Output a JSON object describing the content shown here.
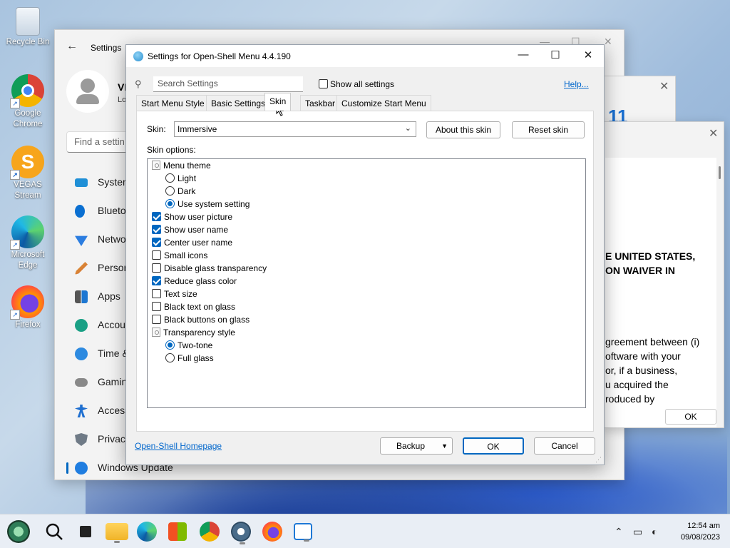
{
  "desktop": {
    "icons": [
      {
        "label": "Recycle Bin",
        "icon": "recycle-bin-icon"
      },
      {
        "label": "Google Chrome",
        "icon": "chrome-icon"
      },
      {
        "label": "VEGAS Stream",
        "icon": "vegas-stream-icon"
      },
      {
        "label": "Microsoft Edge",
        "icon": "edge-icon"
      },
      {
        "label": "Firefox",
        "icon": "firefox-icon"
      }
    ]
  },
  "settings_window": {
    "title": "Settings",
    "user_name": "VI",
    "user_sub": "Lo",
    "find_placeholder": "Find a settin",
    "nav": [
      {
        "label": "System",
        "icon": "monitor-icon"
      },
      {
        "label": "Blueto",
        "icon": "bluetooth-icon"
      },
      {
        "label": "Netwo",
        "icon": "wifi-icon"
      },
      {
        "label": "Person",
        "icon": "brush-icon"
      },
      {
        "label": "Apps",
        "icon": "apps-icon"
      },
      {
        "label": "Accou",
        "icon": "account-icon"
      },
      {
        "label": "Time &",
        "icon": "clock-icon"
      },
      {
        "label": "Gamin",
        "icon": "gamepad-icon"
      },
      {
        "label": "Access",
        "icon": "accessibility-icon"
      },
      {
        "label": "Privacy",
        "icon": "shield-icon"
      },
      {
        "label": "Windows Update",
        "icon": "update-icon"
      }
    ]
  },
  "eula": {
    "heading_line1": "E UNITED STATES,",
    "heading_line2": "ON WAIVER IN",
    "body_lines": [
      "greement between (i)",
      "oftware with your",
      "or, if a business,",
      "u acquired the",
      "roduced by"
    ],
    "ok_label": "OK",
    "logo_text": "11"
  },
  "dialog": {
    "title": "Settings for Open-Shell Menu 4.4.190",
    "search_placeholder": "Search Settings",
    "show_all_label": "Show all settings",
    "help_label": "Help...",
    "tabs": [
      "Start Menu Style",
      "Basic Settings",
      "Skin",
      "Taskbar",
      "Customize Start Menu"
    ],
    "selected_tab": "Skin",
    "skin_label": "Skin:",
    "skin_value": "Immersive",
    "about_skin_label": "About this skin",
    "reset_skin_label": "Reset skin",
    "skin_options_label": "Skin options:",
    "options": [
      {
        "label": "Menu theme",
        "kind": "group"
      },
      {
        "label": "Light",
        "kind": "radio",
        "checked": false
      },
      {
        "label": "Dark",
        "kind": "radio",
        "checked": false
      },
      {
        "label": "Use system setting",
        "kind": "radio",
        "checked": true
      },
      {
        "label": "Show user picture",
        "kind": "check",
        "checked": true
      },
      {
        "label": "Show user name",
        "kind": "check",
        "checked": true
      },
      {
        "label": "Center user name",
        "kind": "check",
        "checked": true
      },
      {
        "label": "Small icons",
        "kind": "check",
        "checked": false
      },
      {
        "label": "Disable glass transparency",
        "kind": "check",
        "checked": false
      },
      {
        "label": "Reduce glass color",
        "kind": "check",
        "checked": true
      },
      {
        "label": "Text size",
        "kind": "check",
        "checked": false
      },
      {
        "label": "Black text on glass",
        "kind": "check",
        "checked": false
      },
      {
        "label": "Black buttons on glass",
        "kind": "check",
        "checked": false
      },
      {
        "label": "Transparency style",
        "kind": "group"
      },
      {
        "label": "Two-tone",
        "kind": "radio",
        "checked": true
      },
      {
        "label": "Full glass",
        "kind": "radio",
        "checked": false
      }
    ],
    "homepage_link": "Open-Shell Homepage",
    "backup_label": "Backup",
    "ok_label": "OK",
    "cancel_label": "Cancel"
  },
  "taskbar": {
    "apps": [
      "start-icon",
      "search-icon",
      "task-view-icon",
      "file-explorer-icon",
      "edge-icon",
      "store-icon",
      "chrome-icon",
      "settings-icon",
      "firefox-icon",
      "open-shell-icon"
    ],
    "time": "12:54 am",
    "date": "09/08/2023"
  },
  "colors": {
    "accent": "#0067c0",
    "link": "#0066cc"
  }
}
